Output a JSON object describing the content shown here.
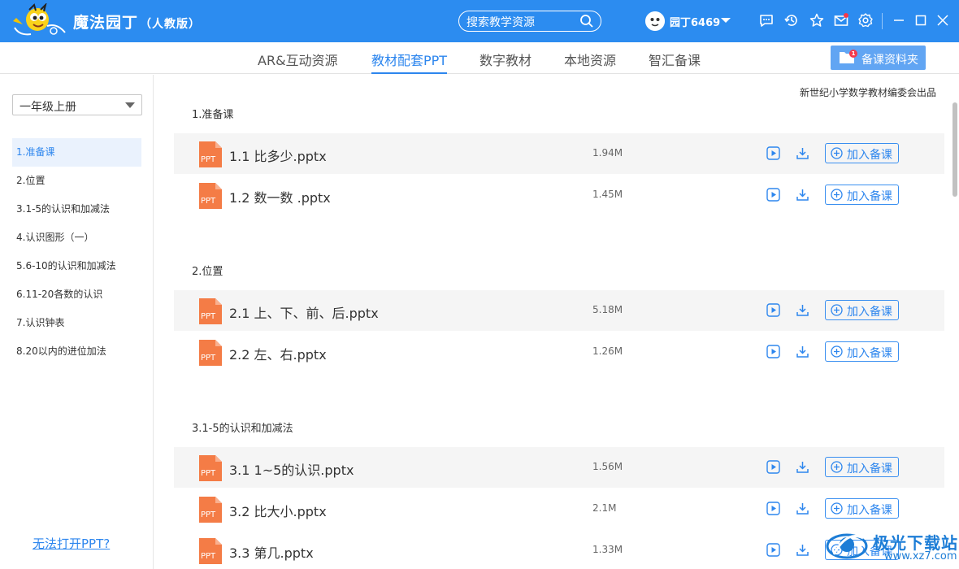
{
  "app": {
    "title": "魔法园丁",
    "edition": "（人教版）",
    "search_placeholder": "搜索教学资源",
    "username": "园丁6469",
    "folder_badge": "1"
  },
  "tabs": [
    "AR&互动资源",
    "教材配套PPT",
    "数字教材",
    "本地资源",
    "智汇备课"
  ],
  "active_tab": "教材配套PPT",
  "folder_button": "备课资料夹",
  "sidebar": {
    "grade": "一年级上册",
    "items": [
      "1.准备课",
      "2.位置",
      "3.1-5的认识和加减法",
      "4.认识图形（一）",
      "5.6-10的认识和加减法",
      "6.11-20各数的认识",
      "7.认识钟表",
      "8.20以内的进位加法"
    ],
    "help_link": "无法打开PPT?"
  },
  "main": {
    "publisher": "新世纪小学数学教材编委会出品",
    "file_type_label": "PPT",
    "add_label": "加入备课",
    "sections": [
      {
        "title": "1.准备课",
        "files": [
          {
            "name": "1.1 比多少.pptx",
            "size": "1.94M"
          },
          {
            "name": "1.2 数一数 .pptx",
            "size": "1.45M"
          }
        ]
      },
      {
        "title": "2.位置",
        "files": [
          {
            "name": "2.1 上、下、前、后.pptx",
            "size": "5.18M"
          },
          {
            "name": "2.2 左、右.pptx",
            "size": "1.26M"
          }
        ]
      },
      {
        "title": "3.1-5的认识和加减法",
        "files": [
          {
            "name": "3.1 1~5的认识.pptx",
            "size": "1.56M"
          },
          {
            "name": "3.2 比大小.pptx",
            "size": "2.1M"
          },
          {
            "name": "3.3 第几.pptx",
            "size": "1.33M"
          }
        ]
      }
    ]
  },
  "watermark": {
    "text": "极光下载站",
    "url": "www.xz7.com"
  },
  "colors": {
    "titlebar": "#2c8cf0",
    "accent": "#2d86ee",
    "ppt_icon": "#f47c46",
    "badge": "#f5394a"
  }
}
